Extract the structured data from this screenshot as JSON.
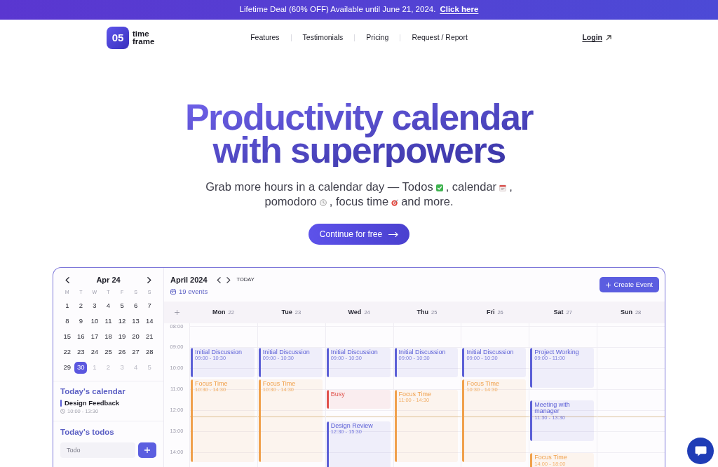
{
  "banner": {
    "text": "Lifetime Deal (60% OFF) Available until June 21, 2024.",
    "link": "Click here"
  },
  "nav": {
    "logo": {
      "mark": "05",
      "name": "time frame"
    },
    "links": [
      "Features",
      "Testimonials",
      "Pricing",
      "Request / Report"
    ],
    "login": "Login"
  },
  "hero": {
    "title": "Productivity calendar with superpowers",
    "tagline": [
      [
        "Grab more hours in a calendar day — Todos",
        ", calendar",
        ","
      ],
      [
        "pomodoro",
        ", focus time",
        "and more."
      ]
    ],
    "cta": "Continue for free"
  },
  "app": {
    "sidebar": {
      "month": "Apr 24",
      "weekdays": [
        "M",
        "T",
        "W",
        "T",
        "F",
        "S",
        "S"
      ],
      "days": [
        {
          "label": "1",
          "in_month": true,
          "selected": false
        },
        {
          "label": "2",
          "in_month": true,
          "selected": false
        },
        {
          "label": "3",
          "in_month": true,
          "selected": false
        },
        {
          "label": "4",
          "in_month": true,
          "selected": false
        },
        {
          "label": "5",
          "in_month": true,
          "selected": false
        },
        {
          "label": "6",
          "in_month": true,
          "selected": false
        },
        {
          "label": "7",
          "in_month": true,
          "selected": false
        },
        {
          "label": "8",
          "in_month": true,
          "selected": false
        },
        {
          "label": "9",
          "in_month": true,
          "selected": false
        },
        {
          "label": "10",
          "in_month": true,
          "selected": false
        },
        {
          "label": "11",
          "in_month": true,
          "selected": false
        },
        {
          "label": "12",
          "in_month": true,
          "selected": false
        },
        {
          "label": "13",
          "in_month": true,
          "selected": false
        },
        {
          "label": "14",
          "in_month": true,
          "selected": false
        },
        {
          "label": "15",
          "in_month": true,
          "selected": false
        },
        {
          "label": "16",
          "in_month": true,
          "selected": false
        },
        {
          "label": "17",
          "in_month": true,
          "selected": false
        },
        {
          "label": "18",
          "in_month": true,
          "selected": false
        },
        {
          "label": "19",
          "in_month": true,
          "selected": false
        },
        {
          "label": "20",
          "in_month": true,
          "selected": false
        },
        {
          "label": "21",
          "in_month": true,
          "selected": false
        },
        {
          "label": "22",
          "in_month": true,
          "selected": false
        },
        {
          "label": "23",
          "in_month": true,
          "selected": false
        },
        {
          "label": "24",
          "in_month": true,
          "selected": false
        },
        {
          "label": "25",
          "in_month": true,
          "selected": false
        },
        {
          "label": "26",
          "in_month": true,
          "selected": false
        },
        {
          "label": "27",
          "in_month": true,
          "selected": false
        },
        {
          "label": "28",
          "in_month": true,
          "selected": false
        },
        {
          "label": "29",
          "in_month": true,
          "selected": false
        },
        {
          "label": "30",
          "in_month": true,
          "selected": true
        },
        {
          "label": "1",
          "in_month": false,
          "selected": false
        },
        {
          "label": "2",
          "in_month": false,
          "selected": false
        },
        {
          "label": "3",
          "in_month": false,
          "selected": false
        },
        {
          "label": "4",
          "in_month": false,
          "selected": false
        },
        {
          "label": "5",
          "in_month": false,
          "selected": false
        }
      ],
      "today_calendar": {
        "title": "Today's calendar",
        "events": [
          {
            "title": "Design Feedback",
            "time": "10:00 - 13:30",
            "color": "#5b5fd6"
          }
        ]
      },
      "todos": {
        "title": "Today's todos",
        "placeholder": "Todo"
      }
    },
    "header": {
      "month": "April 2024",
      "today_button": "TODAY",
      "event_count": "19 events",
      "create_button": "Create Event"
    },
    "hours": [
      "08:00",
      "09:00",
      "10:00",
      "11:00",
      "12:00",
      "13:00",
      "14:00"
    ],
    "days": [
      {
        "name": "Mon",
        "date": "22",
        "events": [
          {
            "title": "Initial Discussion",
            "time": "09:00 - 10:30",
            "color": "#5b5fd6"
          },
          {
            "title": "Focus Time",
            "time": "10:30 - 14:30",
            "color": "#f0a04b"
          }
        ]
      },
      {
        "name": "Tue",
        "date": "23",
        "events": [
          {
            "title": "Initial Discussion",
            "time": "09:00 - 10:30",
            "color": "#5b5fd6"
          },
          {
            "title": "Focus Time",
            "time": "10:30 - 14:30",
            "color": "#f0a04b"
          }
        ]
      },
      {
        "name": "Wed",
        "date": "24",
        "events": [
          {
            "title": "Initial Discussion",
            "time": "09:00 - 10:30",
            "color": "#5b5fd6"
          },
          {
            "title": "Busy",
            "color": "#e0524c"
          },
          {
            "title": "Design Review",
            "time": "12:30 - 15:30",
            "color": "#5b5fd6"
          }
        ]
      },
      {
        "name": "Thu",
        "date": "25",
        "events": [
          {
            "title": "Initial Discussion",
            "time": "09:00 - 10:30",
            "color": "#5b5fd6"
          },
          {
            "title": "Focus Time",
            "time": "11:00 - 14:30",
            "color": "#f0a04b"
          }
        ]
      },
      {
        "name": "Fri",
        "date": "26",
        "events": [
          {
            "title": "Initial Discussion",
            "time": "09:00 - 10:30",
            "color": "#5b5fd6"
          },
          {
            "title": "Focus Time",
            "time": "10:30 - 14:30",
            "color": "#f0a04b"
          }
        ]
      },
      {
        "name": "Sat",
        "date": "27",
        "events": [
          {
            "title": "Project Working",
            "time": "09:00 - 11:00",
            "color": "#5b5fd6"
          },
          {
            "title": "Meeting with manager",
            "time": "11:30 - 13:30",
            "color": "#5b5fd6"
          },
          {
            "title": "Focus Time",
            "time": "14:00 - 18:00",
            "color": "#f0a04b"
          }
        ]
      },
      {
        "name": "Sun",
        "date": "28"
      }
    ]
  }
}
